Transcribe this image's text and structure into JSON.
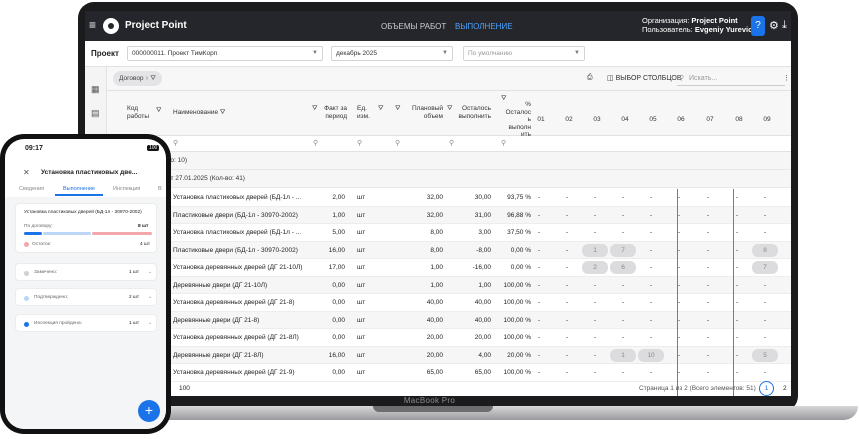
{
  "app": {
    "name": "Project Point"
  },
  "nav": {
    "item1": "ОБЪЕМЫ РАБОТ",
    "item2": "ВЫПОЛНЕНИЕ"
  },
  "account": {
    "org_label": "Организация:",
    "org_value": "Project Point",
    "user_label": "Пользователь:",
    "user_value": "Evgeniy Yurevich"
  },
  "filters": {
    "project_label": "Проект",
    "project": "000000011. Проект ТимКорп",
    "period": "декабрь 2025",
    "view_placeholder": "По умолчанию"
  },
  "toolbar": {
    "chip": "Договор",
    "columns": "ВЫБОР СТОЛБЦОВ",
    "search_placeholder": "Искать..."
  },
  "columns": {
    "code": [
      "Код",
      "работы"
    ],
    "name": "Наименование",
    "fact": [
      "Факт за",
      "период"
    ],
    "unit": [
      "Ед.",
      "изм."
    ],
    "plan": [
      "Плановый",
      "объем"
    ],
    "remain": [
      "Осталось",
      "выполнить"
    ],
    "pct": [
      "%",
      "Осталос",
      "ь",
      "выполн",
      "ить"
    ],
    "days": [
      "01",
      "02",
      "03",
      "04",
      "05",
      "06",
      "07",
      "08",
      "09"
    ]
  },
  "groups": {
    "g1": "во: 10)",
    "g2": "от 27.01.2025 (Кол-во: 41)"
  },
  "rows": [
    {
      "name": "Установка пластиковых дверей (БД-1л - ...",
      "fact": "2,00",
      "unit": "шт",
      "plan": "32,00",
      "remain": "30,00",
      "pct": "93,75 %",
      "d": [
        "-",
        "-",
        "-",
        "-",
        "-",
        "-",
        "-",
        "-",
        "-"
      ]
    },
    {
      "name": "Пластиковые двери (БД-1л - 30970-2002)",
      "fact": "1,00",
      "unit": "шт",
      "plan": "32,00",
      "remain": "31,00",
      "pct": "96,88 %",
      "d": [
        "-",
        "-",
        "-",
        "-",
        "-",
        "-",
        "-",
        "-",
        "-"
      ]
    },
    {
      "name": "Установка пластиковых дверей (БД-1л - ...",
      "fact": "5,00",
      "unit": "шт",
      "plan": "8,00",
      "remain": "3,00",
      "pct": "37,50 %",
      "d": [
        "-",
        "-",
        "-",
        "-",
        "-",
        "-",
        "-",
        "-",
        "-"
      ]
    },
    {
      "name": "Пластиковые двери (БД-1л - 30970-2002)",
      "fact": "16,00",
      "unit": "шт",
      "plan": "8,00",
      "remain": "-8,00",
      "pct": "0,00 %",
      "d": [
        "-",
        "-",
        "1",
        "7",
        "-",
        "-",
        "-",
        "-",
        "8"
      ]
    },
    {
      "name": "Установка деревянных дверей (ДГ 21-10Л)",
      "fact": "17,00",
      "unit": "шт",
      "plan": "1,00",
      "remain": "-16,00",
      "pct": "0,00 %",
      "d": [
        "-",
        "-",
        "2",
        "6",
        "-",
        "-",
        "-",
        "-",
        "7"
      ]
    },
    {
      "name": "Деревянные двери (ДГ 21-10Л)",
      "fact": "0,00",
      "unit": "шт",
      "plan": "1,00",
      "remain": "1,00",
      "pct": "100,00 %",
      "d": [
        "-",
        "-",
        "-",
        "-",
        "-",
        "-",
        "-",
        "-",
        "-"
      ]
    },
    {
      "name": "Установка деревянных дверей (ДГ 21-8)",
      "fact": "0,00",
      "unit": "шт",
      "plan": "40,00",
      "remain": "40,00",
      "pct": "100,00 %",
      "d": [
        "-",
        "-",
        "-",
        "-",
        "-",
        "-",
        "-",
        "-",
        "-"
      ]
    },
    {
      "name": "Деревянные двери (ДГ 21-8)",
      "fact": "0,00",
      "unit": "шт",
      "plan": "40,00",
      "remain": "40,00",
      "pct": "100,00 %",
      "d": [
        "-",
        "-",
        "-",
        "-",
        "-",
        "-",
        "-",
        "-",
        "-"
      ]
    },
    {
      "name": "Установка деревянных дверей (ДГ 21-8Л)",
      "fact": "0,00",
      "unit": "шт",
      "plan": "20,00",
      "remain": "20,00",
      "pct": "100,00 %",
      "d": [
        "-",
        "-",
        "-",
        "-",
        "-",
        "-",
        "-",
        "-",
        "-"
      ]
    },
    {
      "name": "Деревянные двери (ДГ 21-8Л)",
      "fact": "16,00",
      "unit": "шт",
      "plan": "20,00",
      "remain": "4,00",
      "pct": "20,00 %",
      "d": [
        "-",
        "-",
        "-",
        "1",
        "10",
        "-",
        "-",
        "-",
        "5"
      ]
    },
    {
      "name": "Установка деревянных дверей (ДГ 21-9)",
      "fact": "0,00",
      "unit": "шт",
      "plan": "65,00",
      "remain": "65,00",
      "pct": "100,00 %",
      "d": [
        "-",
        "-",
        "-",
        "-",
        "-",
        "-",
        "-",
        "-",
        "-"
      ]
    }
  ],
  "footer": {
    "page_size": "100",
    "info": "Страница 1 из 2 (Всего элементов: 51)",
    "page1": "1",
    "page2": "2"
  },
  "device": {
    "brand": "MacBook Pro"
  },
  "mobile": {
    "time": "09:17",
    "battery": "100",
    "title": "Установка пластиковых две...",
    "tabs": [
      "Сведения",
      "Выполнение",
      "Инспекция",
      "В"
    ],
    "item": "Установка пластиковых дверей (БД-1л - 30970-2002)",
    "contract_label": "По договору:",
    "contract_value": "8 шт",
    "remain_label": "Остаток:",
    "remain_value": "4 шт",
    "status1_label": "Замечено:",
    "status1_value": "1 шт",
    "status2_label": "Подтверждено:",
    "status2_value": "2 шт",
    "status3_label": "Инспекция пройдена:",
    "status3_value": "1 шт"
  },
  "colors": {
    "accent": "#1a73e8",
    "topbar": "#24262b",
    "marker": "#d9534f"
  }
}
